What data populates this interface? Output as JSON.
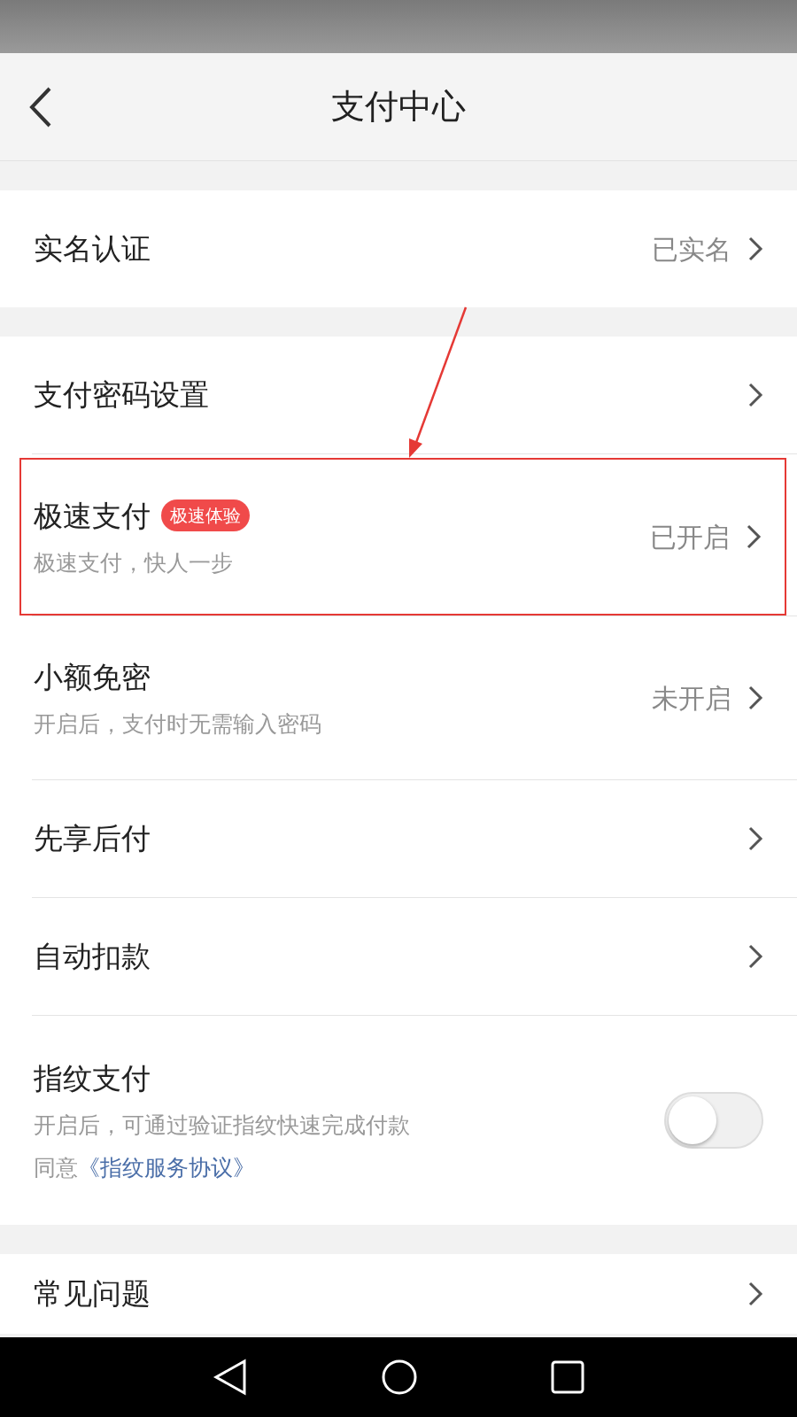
{
  "header": {
    "title": "支付中心"
  },
  "groups": [
    {
      "items": [
        {
          "kind": "nav",
          "label": "实名认证",
          "value": "已实名",
          "highlighted": false
        }
      ]
    },
    {
      "items": [
        {
          "kind": "nav",
          "label": "支付密码设置",
          "highlighted": false
        },
        {
          "kind": "nav",
          "label": "极速支付",
          "badge": "极速体验",
          "subtitle": "极速支付，快人一步",
          "value": "已开启",
          "highlighted": true
        },
        {
          "kind": "nav",
          "label": "小额免密",
          "subtitle": "开启后，支付时无需输入密码",
          "value": "未开启",
          "highlighted": false
        },
        {
          "kind": "nav",
          "label": "先享后付",
          "highlighted": false
        },
        {
          "kind": "nav",
          "label": "自动扣款",
          "highlighted": false
        },
        {
          "kind": "toggle",
          "label": "指纹支付",
          "subtitle": "开启后，可通过验证指纹快速完成付款",
          "agreement_prefix": "同意",
          "agreement_link": "《指纹服务协议》",
          "on": false,
          "highlighted": false
        }
      ]
    },
    {
      "items": [
        {
          "kind": "nav",
          "label": "常见问题",
          "highlighted": false
        }
      ]
    }
  ]
}
